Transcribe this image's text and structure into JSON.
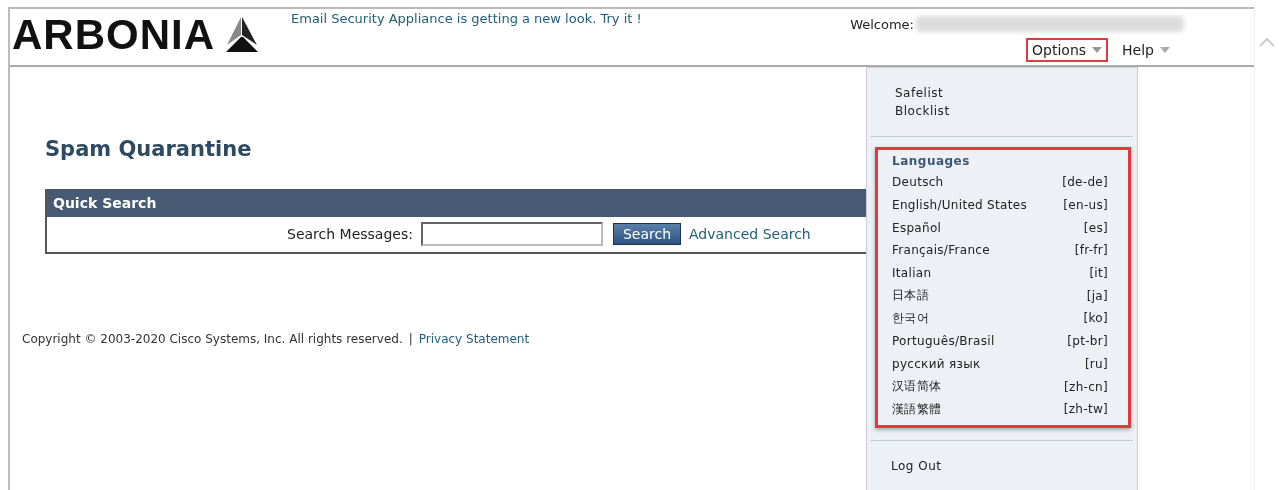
{
  "header": {
    "logo": "ARBONIA",
    "announcement": "Email Security Appliance is getting a new look. Try it !",
    "welcome_label": "Welcome:",
    "welcome_redacted": true,
    "nav": [
      {
        "label": "Options",
        "expanded": true,
        "highlighted": true
      },
      {
        "label": "Help",
        "expanded": false,
        "highlighted": false
      }
    ]
  },
  "page_title": "Spam Quarantine",
  "quick_search": {
    "title": "Quick Search",
    "label": "Search Messages:",
    "button": "Search",
    "link": "Advanced Search"
  },
  "footer": {
    "copyright": "Copyright © 2003-2020 Cisco Systems, Inc. All rights reserved.",
    "separator": "|",
    "link": "Privacy Statement"
  },
  "options_menu": {
    "items": [
      {
        "label": "Safelist"
      },
      {
        "label": "Blocklist"
      }
    ],
    "languages": {
      "title": "Languages",
      "highlighted": true,
      "items": [
        {
          "name": "Deutsch",
          "code": "[de-de]"
        },
        {
          "name": "English/United States",
          "code": "[en-us]"
        },
        {
          "name": "Español",
          "code": "[es]"
        },
        {
          "name": "Français/France",
          "code": "[fr-fr]"
        },
        {
          "name": "Italian",
          "code": "[it]"
        },
        {
          "name": "日本語",
          "code": "[ja]"
        },
        {
          "name": "한국어",
          "code": "[ko]"
        },
        {
          "name": "Português/Brasil",
          "code": "[pt-br]"
        },
        {
          "name": "русский язык",
          "code": "[ru]"
        },
        {
          "name": "汉语简体",
          "code": "[zh-cn]"
        },
        {
          "name": "漢語繁體",
          "code": "[zh-tw]"
        }
      ]
    },
    "logout": "Log Out"
  }
}
